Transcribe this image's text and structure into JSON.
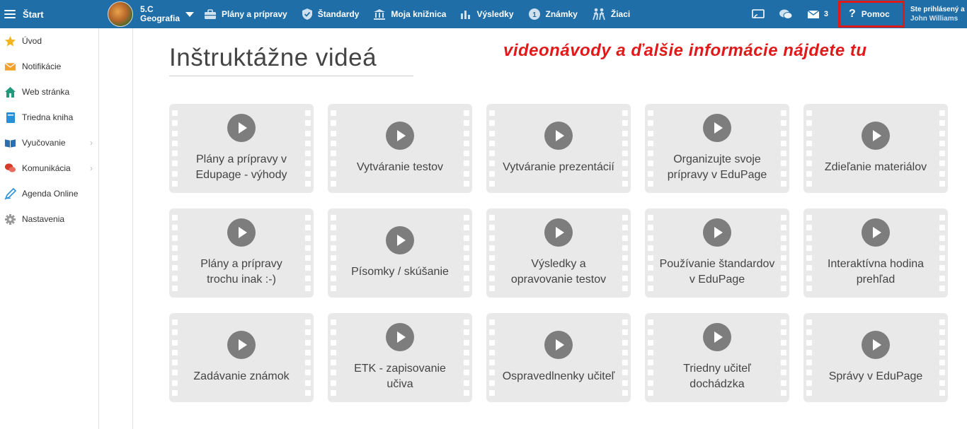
{
  "topbar": {
    "start_label": "Štart",
    "class_name": "5.C",
    "subject": "Geografia",
    "nav": [
      {
        "label": "Plány a prípravy",
        "icon": "briefcase-icon"
      },
      {
        "label": "Štandardy",
        "icon": "shield-icon"
      },
      {
        "label": "Moja knižnica",
        "icon": "library-icon"
      },
      {
        "label": "Výsledky",
        "icon": "bar-chart-icon"
      },
      {
        "label": "Známky",
        "icon": "grades-icon"
      },
      {
        "label": "Žiaci",
        "icon": "students-icon"
      }
    ],
    "message_count": "3",
    "help_label": "Pomoc",
    "logged_in_label": "Ste prihlásený a",
    "user_name": "John Williams",
    "accent_color": "#1f6ea8",
    "highlight_color": "#e01a1a"
  },
  "sidebar": {
    "items": [
      {
        "label": "Úvod",
        "icon": "star-icon"
      },
      {
        "label": "Notifikácie",
        "icon": "envelope-icon"
      },
      {
        "label": "Web stránka",
        "icon": "home-icon"
      },
      {
        "label": "Triedna kniha",
        "icon": "book-icon"
      },
      {
        "label": "Vyučovanie",
        "icon": "open-book-icon"
      },
      {
        "label": "Komunikácia",
        "icon": "chat-icon"
      },
      {
        "label": "Agenda Online",
        "icon": "pen-icon"
      },
      {
        "label": "Nastavenia",
        "icon": "gear-icon"
      }
    ]
  },
  "main": {
    "title": "Inštruktážne videá",
    "annotation": "videonávody a ďalšie informácie nájdete tu",
    "videos": [
      {
        "label": "Plány a prípravy v Edupage - výhody"
      },
      {
        "label": "Vytváranie testov"
      },
      {
        "label": "Vytváranie prezentácií"
      },
      {
        "label": "Organizujte svoje prípravy v EduPage"
      },
      {
        "label": "Zdieľanie materiálov"
      },
      {
        "label": "Plány a prípravy trochu inak :-)"
      },
      {
        "label": "Písomky / skúšanie"
      },
      {
        "label": "Výsledky a opravovanie testov"
      },
      {
        "label": "Používanie štandardov v EduPage"
      },
      {
        "label": "Interaktívna hodina prehľad"
      },
      {
        "label": "Zadávanie známok"
      },
      {
        "label": "ETK - zapisovanie učiva"
      },
      {
        "label": "Ospravedlnenky učiteľ"
      },
      {
        "label": "Triedny učiteľ dochádzka"
      },
      {
        "label": "Správy v EduPage"
      }
    ]
  }
}
